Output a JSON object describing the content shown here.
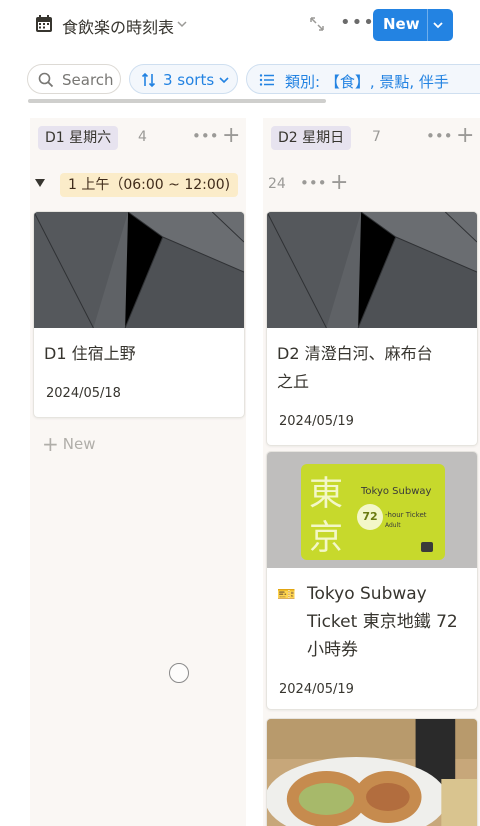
{
  "header": {
    "title": "食飲楽の時刻表",
    "new_label": "New",
    "more_label": "•••"
  },
  "toolbar": {
    "search_label": "Search",
    "sorts_label": "3 sorts",
    "filter_label": "類別: 【食】, 景點, 伴手"
  },
  "columns": [
    {
      "label": "D1 星期六",
      "count": "4"
    },
    {
      "label": "D2 星期日",
      "count": "7"
    }
  ],
  "group": {
    "label": "1 上午（06:00 ~ 12:00)",
    "count": "24"
  },
  "cards": [
    {
      "title": "D1 住宿上野",
      "date": "2024/05/18"
    },
    {
      "title_line1": "D2 清澄白河、麻布台",
      "title_line2": "之丘",
      "date": "2024/05/19"
    },
    {
      "ticket_emoji": "🎫",
      "title_line1": "Tokyo Subway",
      "title_line2": "Ticket 東京地鐵 72",
      "title_line3": "小時券",
      "date": "2024/05/19",
      "cover_text": {
        "kanji1": "東",
        "kanji2": "京",
        "brand": "Tokyo Subway",
        "hours": "72",
        "ticket": "-hour Ticket",
        "adult": "Adult"
      }
    }
  ],
  "new_row_label": "New",
  "colors": {
    "accent": "#2383e2",
    "column_tag": "#e7e3ef",
    "group_tag": "#fbecc9",
    "column_bg": "#faf7f4",
    "ticket_green": "#c7d92c"
  }
}
